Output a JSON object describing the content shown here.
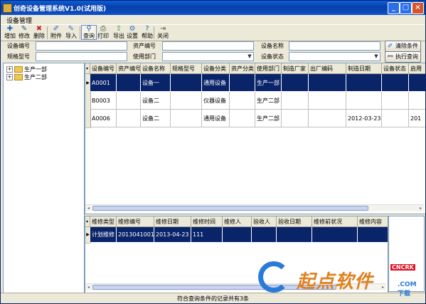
{
  "window": {
    "title": "创奇设备管理系统V1.0(试用版)",
    "min_label": "_",
    "max_label": "□",
    "close_label": "×"
  },
  "menu": {
    "item": "设备管理"
  },
  "toolbar": {
    "buttons": [
      {
        "label": "增加",
        "icon": "add-icon",
        "glyph": "✚",
        "color": "#1a5fc8"
      },
      {
        "label": "修改",
        "icon": "edit-icon",
        "glyph": "✎",
        "color": "#2050a0"
      },
      {
        "label": "删除",
        "icon": "delete-icon",
        "glyph": "✖",
        "color": "#d02020"
      },
      {
        "label": "附件",
        "icon": "attach-icon",
        "glyph": "✐",
        "color": "#2070c0"
      },
      {
        "label": "导入",
        "icon": "import-icon",
        "glyph": "✎",
        "color": "#3080d0"
      },
      {
        "label": "查询",
        "icon": "search-icon",
        "glyph": "⚲",
        "color": "#2060b0"
      },
      {
        "label": "打印",
        "icon": "print-icon",
        "glyph": "⎙",
        "color": "#404040"
      },
      {
        "label": "导出",
        "icon": "export-icon",
        "glyph": "⇪",
        "color": "#20a040"
      },
      {
        "label": "设置",
        "icon": "settings-icon",
        "glyph": "⚙",
        "color": "#3070c0"
      },
      {
        "label": "帮助",
        "icon": "help-icon",
        "glyph": "?",
        "color": "#2060c0"
      },
      {
        "label": "关闭",
        "icon": "close-icon",
        "glyph": "⇥",
        "color": "#606060"
      }
    ]
  },
  "filters": {
    "device_no": {
      "label": "设备编号",
      "value": ""
    },
    "asset_no": {
      "label": "资产编号",
      "value": ""
    },
    "device_name": {
      "label": "设备名称",
      "value": ""
    },
    "spec_model": {
      "label": "规格型号",
      "value": ""
    },
    "dept": {
      "label": "使用部门",
      "value": ""
    },
    "status": {
      "label": "设备状态",
      "value": ""
    },
    "clear_button": "清除条件",
    "query_button": "执行查询"
  },
  "tree": {
    "nodes": [
      {
        "label": "生产一部",
        "expander": "+"
      },
      {
        "label": "生产二部",
        "expander": "+"
      }
    ]
  },
  "device_table": {
    "headers": [
      "设备编号",
      "资产编号",
      "设备名称",
      "规格型号",
      "设备分类",
      "资产分类",
      "使用部门",
      "制造厂家",
      "出厂编码",
      "制造日期",
      "设备状态",
      "启用"
    ],
    "rows": [
      [
        "A0001",
        "",
        "设备一",
        "",
        "通用设备",
        "",
        "生产一部",
        "",
        "",
        "",
        "",
        ""
      ],
      [
        "B0003",
        "",
        "设备二",
        "",
        "仪器设备",
        "",
        "生产二部",
        "",
        "",
        "",
        "",
        ""
      ],
      [
        "A0006",
        "",
        "设备二",
        "",
        "通用设备",
        "",
        "生产二部",
        "",
        "",
        "2012-03-23",
        "",
        "201"
      ]
    ],
    "selected_row": 0,
    "current_indicator": "▶",
    "scroll_left": "◂",
    "scroll_right": "▸"
  },
  "repair_table": {
    "headers": [
      "维修类型",
      "维修编号",
      "维修日期",
      "维修时间",
      "维修人",
      "验收人",
      "验收日期",
      "维修前状况",
      "维修内容"
    ],
    "rows": [
      [
        "计划维修",
        "2013041001",
        "2013-04-23",
        "111",
        "",
        "",
        "",
        "",
        ""
      ]
    ],
    "selected_row": 0,
    "current_indicator": "▶",
    "scroll_left": "◂",
    "scroll_right": "▸"
  },
  "status_bar": {
    "text": "符合查询条件的记录共有3条"
  },
  "watermark": {
    "text": "起点软件",
    "tag": "CNCRK",
    "suffix": ".COM 下载"
  }
}
